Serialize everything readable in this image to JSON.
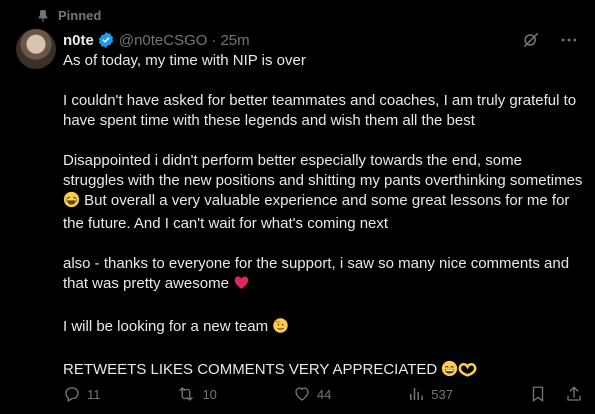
{
  "pinned_label": "Pinned",
  "author": {
    "display_name": "n0te",
    "handle": "@n0teCSGO",
    "time": "25m",
    "verified": true
  },
  "tweet": {
    "line1": "As of today, my time with NIP is over",
    "para2": "I couldn't have asked for better teammates and coaches, I am truly grateful to have spent time with these legends and wish them all the best",
    "para3_before_emoji": "Disappointed i didn't perform better especially towards the end, some struggles with the new positions and shitting my pants overthinking sometimes",
    "para3_after_emoji": " But overall a very valuable experience and some great lessons for me for the future. And I can't wait for what's coming next",
    "para4": "also - thanks to everyone for the support, i saw so many nice comments and that was pretty awesome",
    "para5": "I will be looking for a new team",
    "para6": "RETWEETS LIKES COMMENTS VERY APPRECIATED"
  },
  "actions": {
    "replies": "11",
    "retweets": "10",
    "likes": "44",
    "views": "537"
  },
  "icons": {
    "pinned": "pin-icon",
    "verified": "verified-badge-icon",
    "grok": "grok-icon",
    "more": "more-icon",
    "reply": "reply-icon",
    "retweet": "retweet-icon",
    "like": "heart-icon",
    "views": "views-icon",
    "bookmark": "bookmark-icon",
    "share": "share-icon"
  },
  "colors": {
    "background": "#000000",
    "text": "#e7e9ea",
    "muted": "#71767b",
    "verified": "#1d9bf0",
    "heart_emoji": "#e0245e"
  }
}
